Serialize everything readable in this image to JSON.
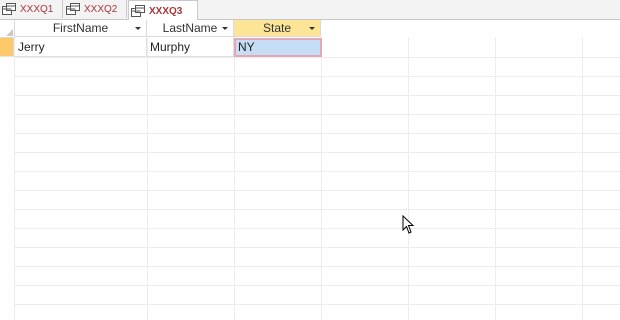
{
  "tabs": [
    {
      "label": "XXXQ1",
      "active": false
    },
    {
      "label": "XXXQ2",
      "active": false
    },
    {
      "label": "XXXQ3",
      "active": true
    }
  ],
  "grid": {
    "columns": [
      "FirstName",
      "LastName",
      "State"
    ],
    "selected_column": "State",
    "rows": [
      {
        "FirstName": "Jerry",
        "LastName": "Murphy",
        "State": "NY"
      }
    ]
  },
  "colors": {
    "tab_text": "#a4373a",
    "selected_header": "#fde597",
    "current_row_marker": "#fbc86a",
    "active_cell": "#c6def5"
  },
  "icons": [
    "query-icon",
    "dropdown-arrow-icon",
    "mouse-cursor-icon"
  ]
}
